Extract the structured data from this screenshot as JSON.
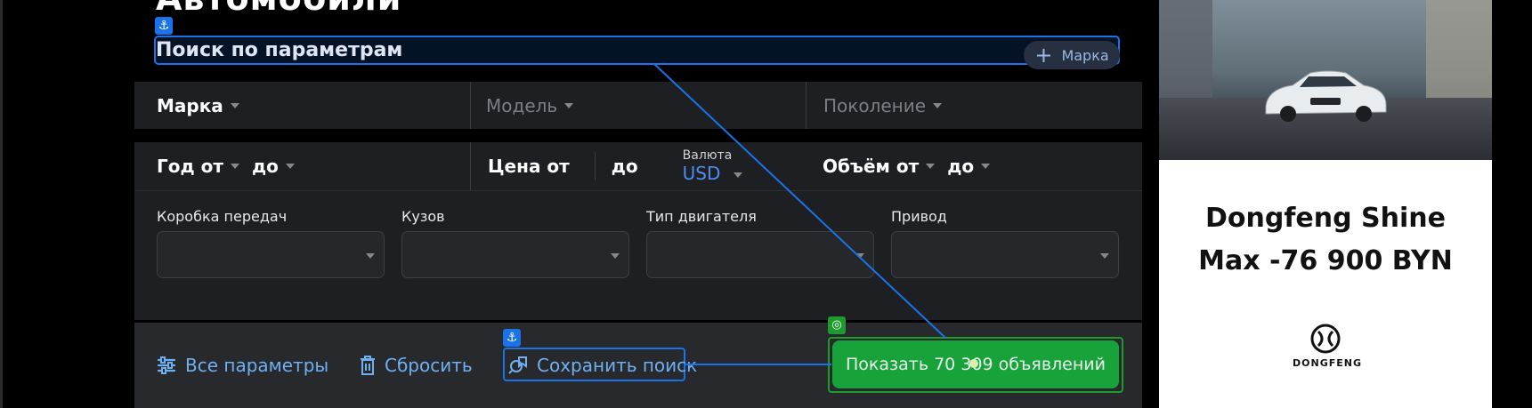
{
  "page": {
    "title": "Автомобили",
    "section_title": "Поиск по параметрам",
    "brand_add_label": "Марка"
  },
  "row1": {
    "brand": "Марка",
    "model": "Модель",
    "generation": "Поколение"
  },
  "row2": {
    "year_from": "Год от",
    "year_to": "до",
    "price_from": "Цена от",
    "price_to": "до",
    "currency_label": "Валюта",
    "currency_value": "USD",
    "volume_from": "Объём от",
    "volume_to": "до"
  },
  "dropdowns": [
    {
      "label": "Коробка передач",
      "value": ""
    },
    {
      "label": "Кузов",
      "value": ""
    },
    {
      "label": "Тип двигателя",
      "value": ""
    },
    {
      "label": "Привод",
      "value": ""
    }
  ],
  "actions": {
    "all_params": "Все параметры",
    "reset": "Сбросить",
    "save_search": "Сохранить поиск",
    "show_results": "Показать 70 309 объявлений"
  },
  "ad": {
    "title_line1": "Dongfeng Shine",
    "title_line2": "Max -76 900 BYN",
    "logo_text": "DONGFENG"
  },
  "colors": {
    "accent_blue": "#1a73e8",
    "link_blue": "#6fb0f3",
    "success_green": "#17a33a",
    "panel_bg": "#1d1f22"
  },
  "icons": [
    "anchor-icon",
    "plus-icon",
    "sliders-icon",
    "trash-icon",
    "save-search-icon",
    "target-icon",
    "chevron-down-icon",
    "dongfeng-logo-icon"
  ]
}
